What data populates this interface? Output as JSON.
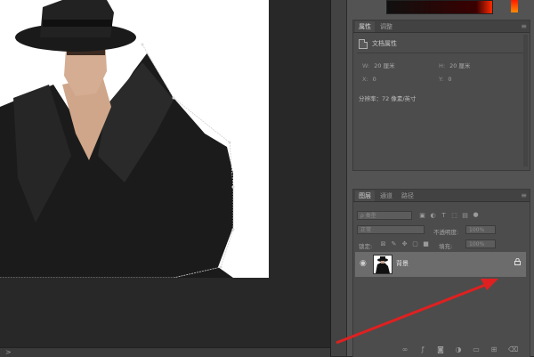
{
  "canvas": {
    "document_background": "#ffffff",
    "status_indicator": ">"
  },
  "properties_panel": {
    "tabs": [
      {
        "label": "属性",
        "active": true
      },
      {
        "label": "调整",
        "active": false
      }
    ],
    "header": "文档属性",
    "width_label": "W:",
    "width_value": "20 厘米",
    "height_label": "H:",
    "height_value": "20 厘米",
    "x_label": "X:",
    "x_value": "0",
    "y_label": "Y:",
    "y_value": "0",
    "resolution": "分辨率：72 像素/英寸"
  },
  "layers_panel": {
    "tabs": [
      {
        "label": "图层",
        "active": true
      },
      {
        "label": "通道",
        "active": false
      },
      {
        "label": "路径",
        "active": false
      }
    ],
    "filter_placeholder": "ρ 类型",
    "blend_mode": "正常",
    "opacity_label": "不透明度:",
    "opacity_value": "100%",
    "lock_label": "锁定:",
    "fill_label": "填充:",
    "fill_value": "100%",
    "layers": [
      {
        "name": "背景",
        "visible": true,
        "locked": true,
        "selected": true
      }
    ],
    "bottom_icons": [
      "link-icon",
      "fx-icon",
      "mask-icon",
      "adjustment-icon",
      "group-icon",
      "new-layer-icon",
      "trash-icon"
    ]
  },
  "colors": {
    "annotation_arrow": "#e02020",
    "dock_background": "#535353",
    "canvas_background": "#282828",
    "selected_layer": "#6c6c6c"
  }
}
